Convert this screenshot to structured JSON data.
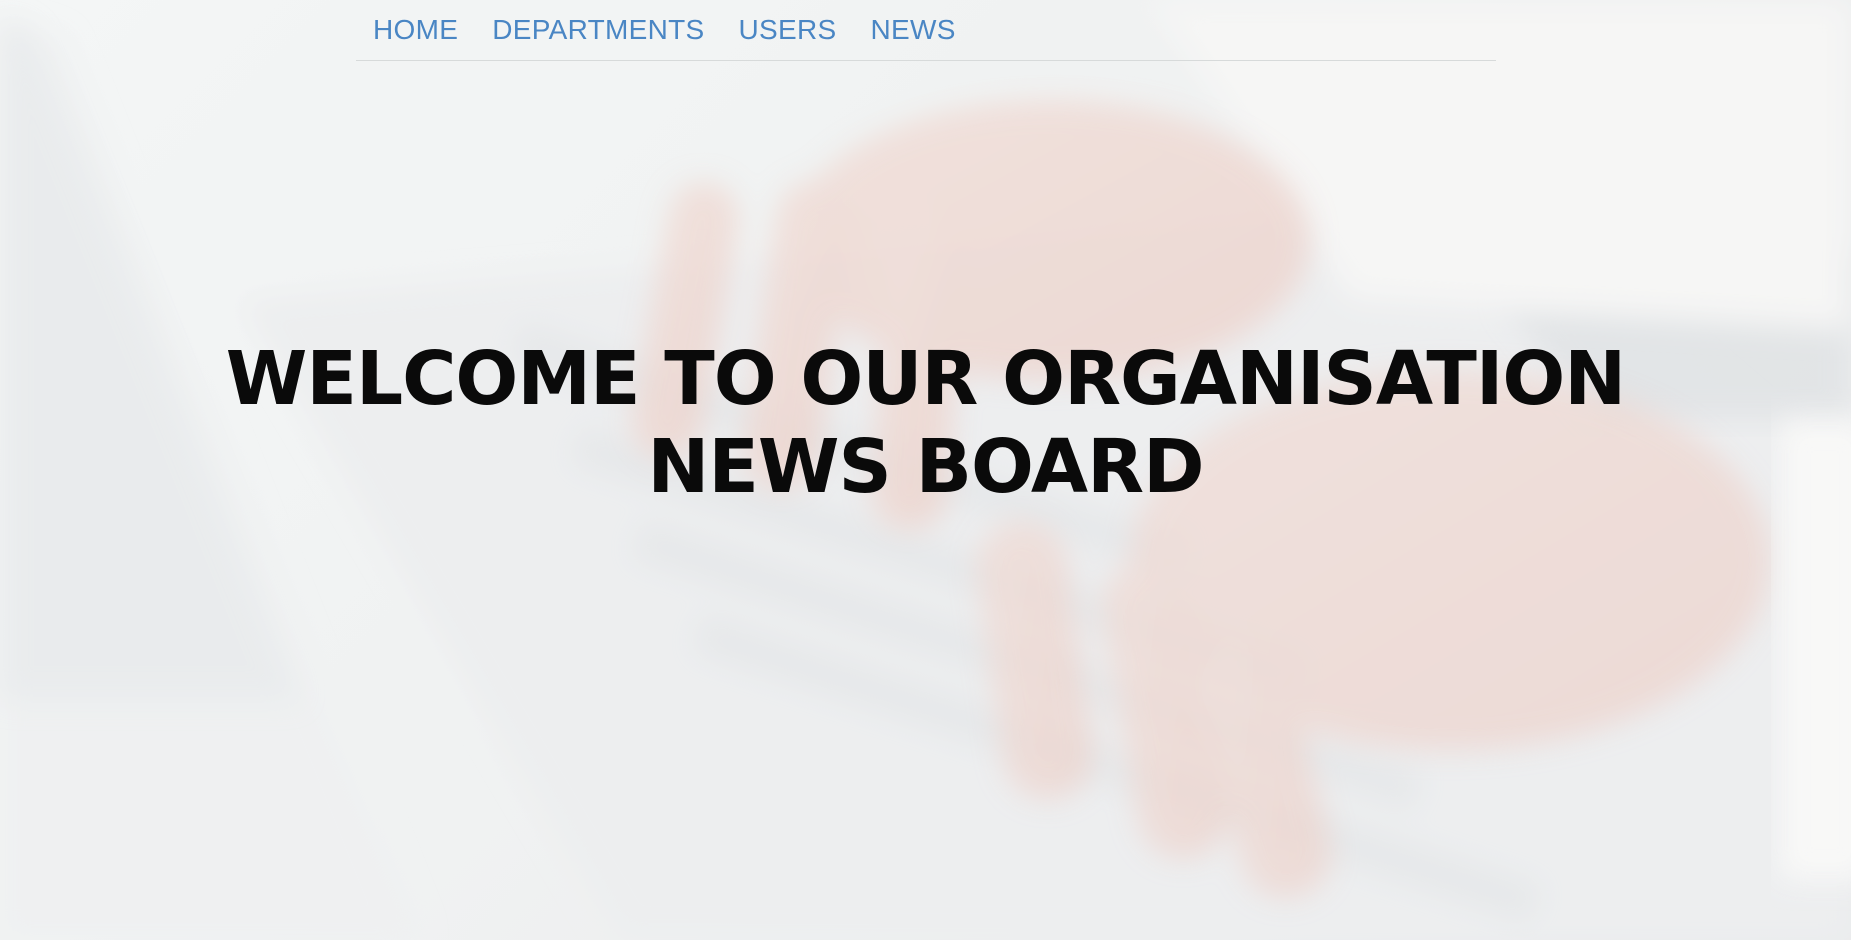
{
  "nav": {
    "items": [
      {
        "label": "HOME"
      },
      {
        "label": "DEPARTMENTS"
      },
      {
        "label": "USERS"
      },
      {
        "label": "NEWS"
      }
    ],
    "link_color": "#4a86c4"
  },
  "hero": {
    "title_line1": "WELCOME TO OUR ORGANISATION",
    "title_line2": "NEWS BOARD",
    "background_image": "laptop-typing-hands-photo"
  }
}
